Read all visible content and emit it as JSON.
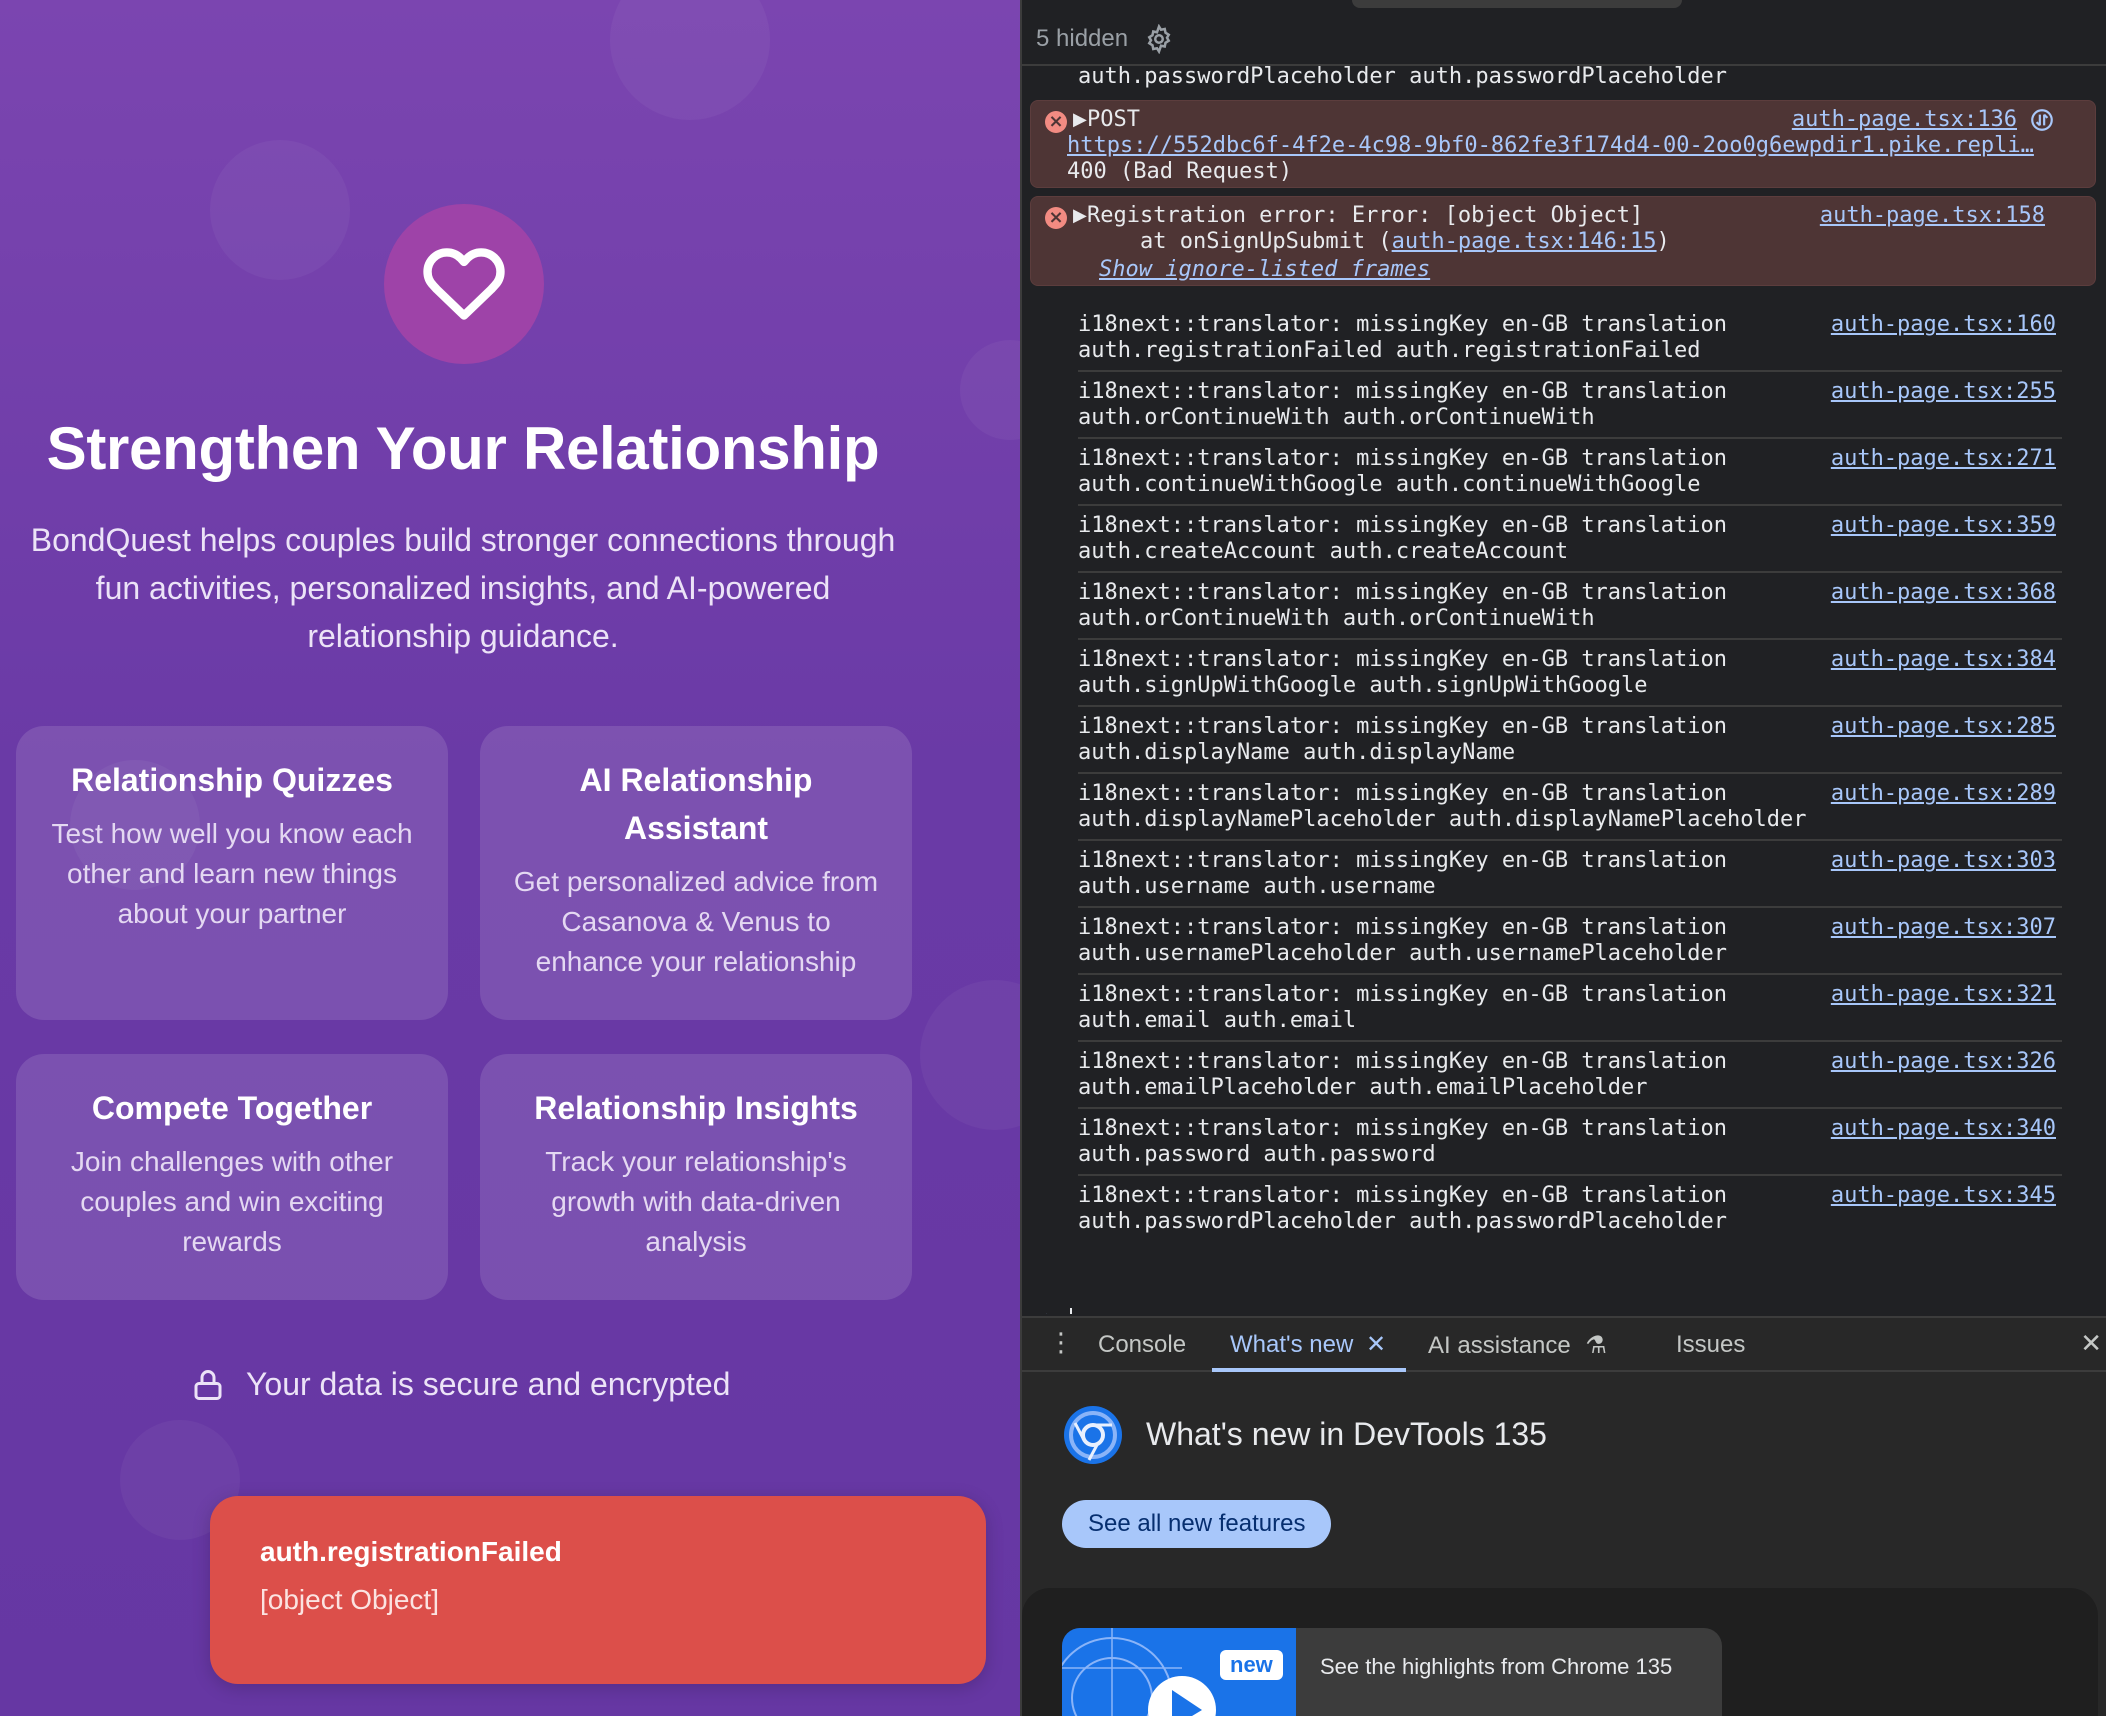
{
  "app": {
    "hero_title": "Strengthen Your Relationship",
    "hero_description": "BondQuest helps couples build stronger connections through fun activities, personalized insights, and AI-powered relationship guidance.",
    "cards": [
      {
        "title": "Relationship Quizzes",
        "text": "Test how well you know each other and learn new things about your partner"
      },
      {
        "title": "AI Relationship Assistant",
        "text": "Get personalized advice from Casanova & Venus to enhance your relationship"
      },
      {
        "title": "Compete Together",
        "text": "Join challenges with other couples and win exciting rewards"
      },
      {
        "title": "Relationship Insights",
        "text": "Track your relationship's growth with data-driven analysis"
      }
    ],
    "secure_text": "Your data is secure and encrypted",
    "toast": {
      "title": "auth.registrationFailed",
      "message": "[object Object]"
    },
    "colors": {
      "background": "#6b3ba6",
      "toast": "#dc4f4a",
      "hero_icon": "#9e43a8"
    }
  },
  "devtools": {
    "hidden_count": "5 hidden",
    "continuation_line": "auth.passwordPlaceholder auth.passwordPlaceholder",
    "errors": [
      {
        "label": "POST",
        "url": "https://552dbc6f-4f2e-4c98-9bf0-862fe3f174d4-00-2oo0g6ewpdir1.pike.repli…",
        "status": "400 (Bad Request)",
        "source": "auth-page.tsx:136"
      },
      {
        "label": "Registration error: Error: [object Object]",
        "stack_prefix": "    at onSignUpSubmit (",
        "stack_link": "auth-page.tsx:146:15",
        "stack_suffix": ")",
        "ignore_frames": "Show ignore-listed frames",
        "source": "auth-page.tsx:158"
      }
    ],
    "messages": [
      {
        "l1": "i18next::translator: missingKey en-GB translation",
        "l2": "auth.registrationFailed auth.registrationFailed",
        "src": "auth-page.tsx:160"
      },
      {
        "l1": "i18next::translator: missingKey en-GB translation",
        "l2": "auth.orContinueWith auth.orContinueWith",
        "src": "auth-page.tsx:255"
      },
      {
        "l1": "i18next::translator: missingKey en-GB translation",
        "l2": "auth.continueWithGoogle auth.continueWithGoogle",
        "src": "auth-page.tsx:271"
      },
      {
        "l1": "i18next::translator: missingKey en-GB translation",
        "l2": "auth.createAccount auth.createAccount",
        "src": "auth-page.tsx:359"
      },
      {
        "l1": "i18next::translator: missingKey en-GB translation",
        "l2": "auth.orContinueWith auth.orContinueWith",
        "src": "auth-page.tsx:368"
      },
      {
        "l1": "i18next::translator: missingKey en-GB translation",
        "l2": "auth.signUpWithGoogle auth.signUpWithGoogle",
        "src": "auth-page.tsx:384"
      },
      {
        "l1": "i18next::translator: missingKey en-GB translation",
        "l2": "auth.displayName auth.displayName",
        "src": "auth-page.tsx:285"
      },
      {
        "l1": "i18next::translator: missingKey en-GB translation",
        "l2": "auth.displayNamePlaceholder auth.displayNamePlaceholder",
        "src": "auth-page.tsx:289"
      },
      {
        "l1": "i18next::translator: missingKey en-GB translation",
        "l2": "auth.username auth.username",
        "src": "auth-page.tsx:303"
      },
      {
        "l1": "i18next::translator: missingKey en-GB translation",
        "l2": "auth.usernamePlaceholder auth.usernamePlaceholder",
        "src": "auth-page.tsx:307"
      },
      {
        "l1": "i18next::translator: missingKey en-GB translation",
        "l2": "auth.email auth.email",
        "src": "auth-page.tsx:321"
      },
      {
        "l1": "i18next::translator: missingKey en-GB translation",
        "l2": "auth.emailPlaceholder auth.emailPlaceholder",
        "src": "auth-page.tsx:326"
      },
      {
        "l1": "i18next::translator: missingKey en-GB translation",
        "l2": "auth.password auth.password",
        "src": "auth-page.tsx:340"
      },
      {
        "l1": "i18next::translator: missingKey en-GB translation",
        "l2": "auth.passwordPlaceholder auth.passwordPlaceholder",
        "src": "auth-page.tsx:345"
      }
    ],
    "drawer_tabs": {
      "console": "Console",
      "whats_new": "What's new",
      "ai_assistance": "AI assistance",
      "issues": "Issues"
    },
    "whats_new": {
      "title": "What's new in DevTools 135",
      "button": "See all new features",
      "badge": "new",
      "video_text": "See the highlights from Chrome 135"
    },
    "colors": {
      "error_bg": "#4e3535",
      "link": "#a8c7fa",
      "background": "#202124"
    }
  }
}
